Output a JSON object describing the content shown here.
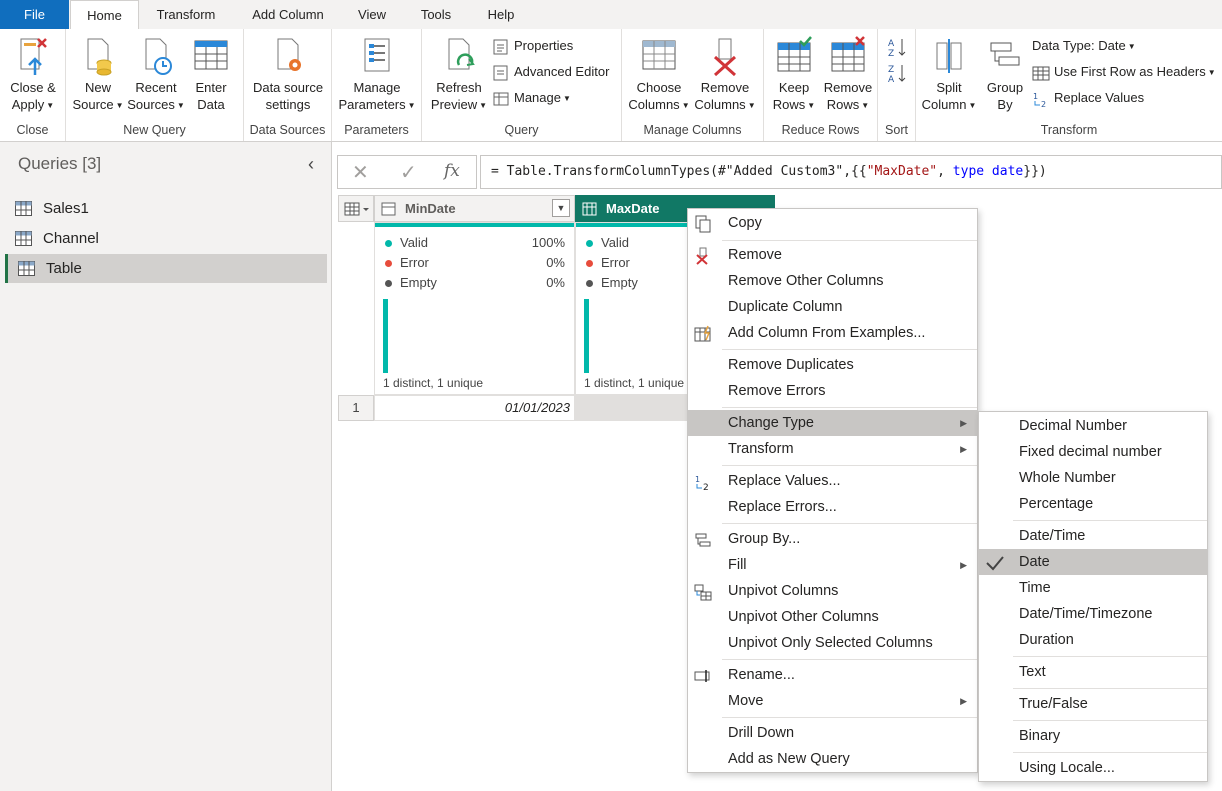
{
  "tabs": [
    "File",
    "Home",
    "Transform",
    "Add Column",
    "View",
    "Tools",
    "Help"
  ],
  "ribbon": {
    "close": {
      "label1": "Close &",
      "label2": "Apply",
      "group": "Close"
    },
    "new_query": {
      "new1": "New",
      "new2": "Source",
      "recent1": "Recent",
      "recent2": "Sources",
      "enter1": "Enter",
      "enter2": "Data",
      "group": "New Query"
    },
    "data_sources": {
      "label1": "Data source",
      "label2": "settings",
      "group": "Data Sources"
    },
    "parameters": {
      "label1": "Manage",
      "label2": "Parameters",
      "group": "Parameters"
    },
    "query": {
      "refresh1": "Refresh",
      "refresh2": "Preview",
      "properties": "Properties",
      "advanced": "Advanced Editor",
      "manage": "Manage",
      "group": "Query"
    },
    "manage_columns": {
      "choose1": "Choose",
      "choose2": "Columns",
      "remove1": "Remove",
      "remove2": "Columns",
      "group": "Manage Columns"
    },
    "reduce_rows": {
      "keep1": "Keep",
      "keep2": "Rows",
      "remove1": "Remove",
      "remove2": "Rows",
      "group": "Reduce Rows"
    },
    "sort": {
      "group": "Sort"
    },
    "transform": {
      "split1": "Split",
      "split2": "Column",
      "group1": "Group",
      "group2": "By",
      "data_type": "Data Type: Date",
      "first_row": "Use First Row as Headers",
      "replace": "Replace Values",
      "group": "Transform"
    }
  },
  "queries": {
    "title": "Queries [3]",
    "items": [
      "Sales1",
      "Channel",
      "Table"
    ],
    "selected": "Table"
  },
  "formula": {
    "prefix": "= Table.TransformColumnTypes(#\"Added Custom3\",{{",
    "col": "\"MaxDate\"",
    "mid": ", ",
    "type_kw": "type",
    "type_name": " date",
    "suffix": "}})"
  },
  "grid": {
    "columns": [
      {
        "name": "MinDate",
        "valid_label": "Valid",
        "valid": "100%",
        "error_label": "Error",
        "error": "0%",
        "empty_label": "Empty",
        "empty": "0%",
        "distinct": "1 distinct, 1 unique"
      },
      {
        "name": "MaxDate",
        "valid_label": "Valid",
        "error_label": "Error",
        "empty_label": "Empty",
        "distinct": "1 distinct, 1 unique"
      }
    ],
    "row_number": "1",
    "row_value": "01/01/2023"
  },
  "context_menu": {
    "items": [
      "Copy",
      "Remove",
      "Remove Other Columns",
      "Duplicate Column",
      "Add Column From Examples...",
      "Remove Duplicates",
      "Remove Errors",
      "Change Type",
      "Transform",
      "Replace Values...",
      "Replace Errors...",
      "Group By...",
      "Fill",
      "Unpivot Columns",
      "Unpivot Other Columns",
      "Unpivot Only Selected Columns",
      "Rename...",
      "Move",
      "Drill Down",
      "Add as New Query"
    ]
  },
  "type_submenu": {
    "items": [
      "Decimal Number",
      "Fixed decimal number",
      "Whole Number",
      "Percentage",
      "Date/Time",
      "Date",
      "Time",
      "Date/Time/Timezone",
      "Duration",
      "Text",
      "True/False",
      "Binary",
      "Using Locale..."
    ],
    "checked": "Date"
  },
  "colors": {
    "accent": "#117865",
    "file_tab": "#106ebe",
    "valid": "#01b8aa",
    "error": "#e74c3c",
    "empty": "#555555"
  }
}
